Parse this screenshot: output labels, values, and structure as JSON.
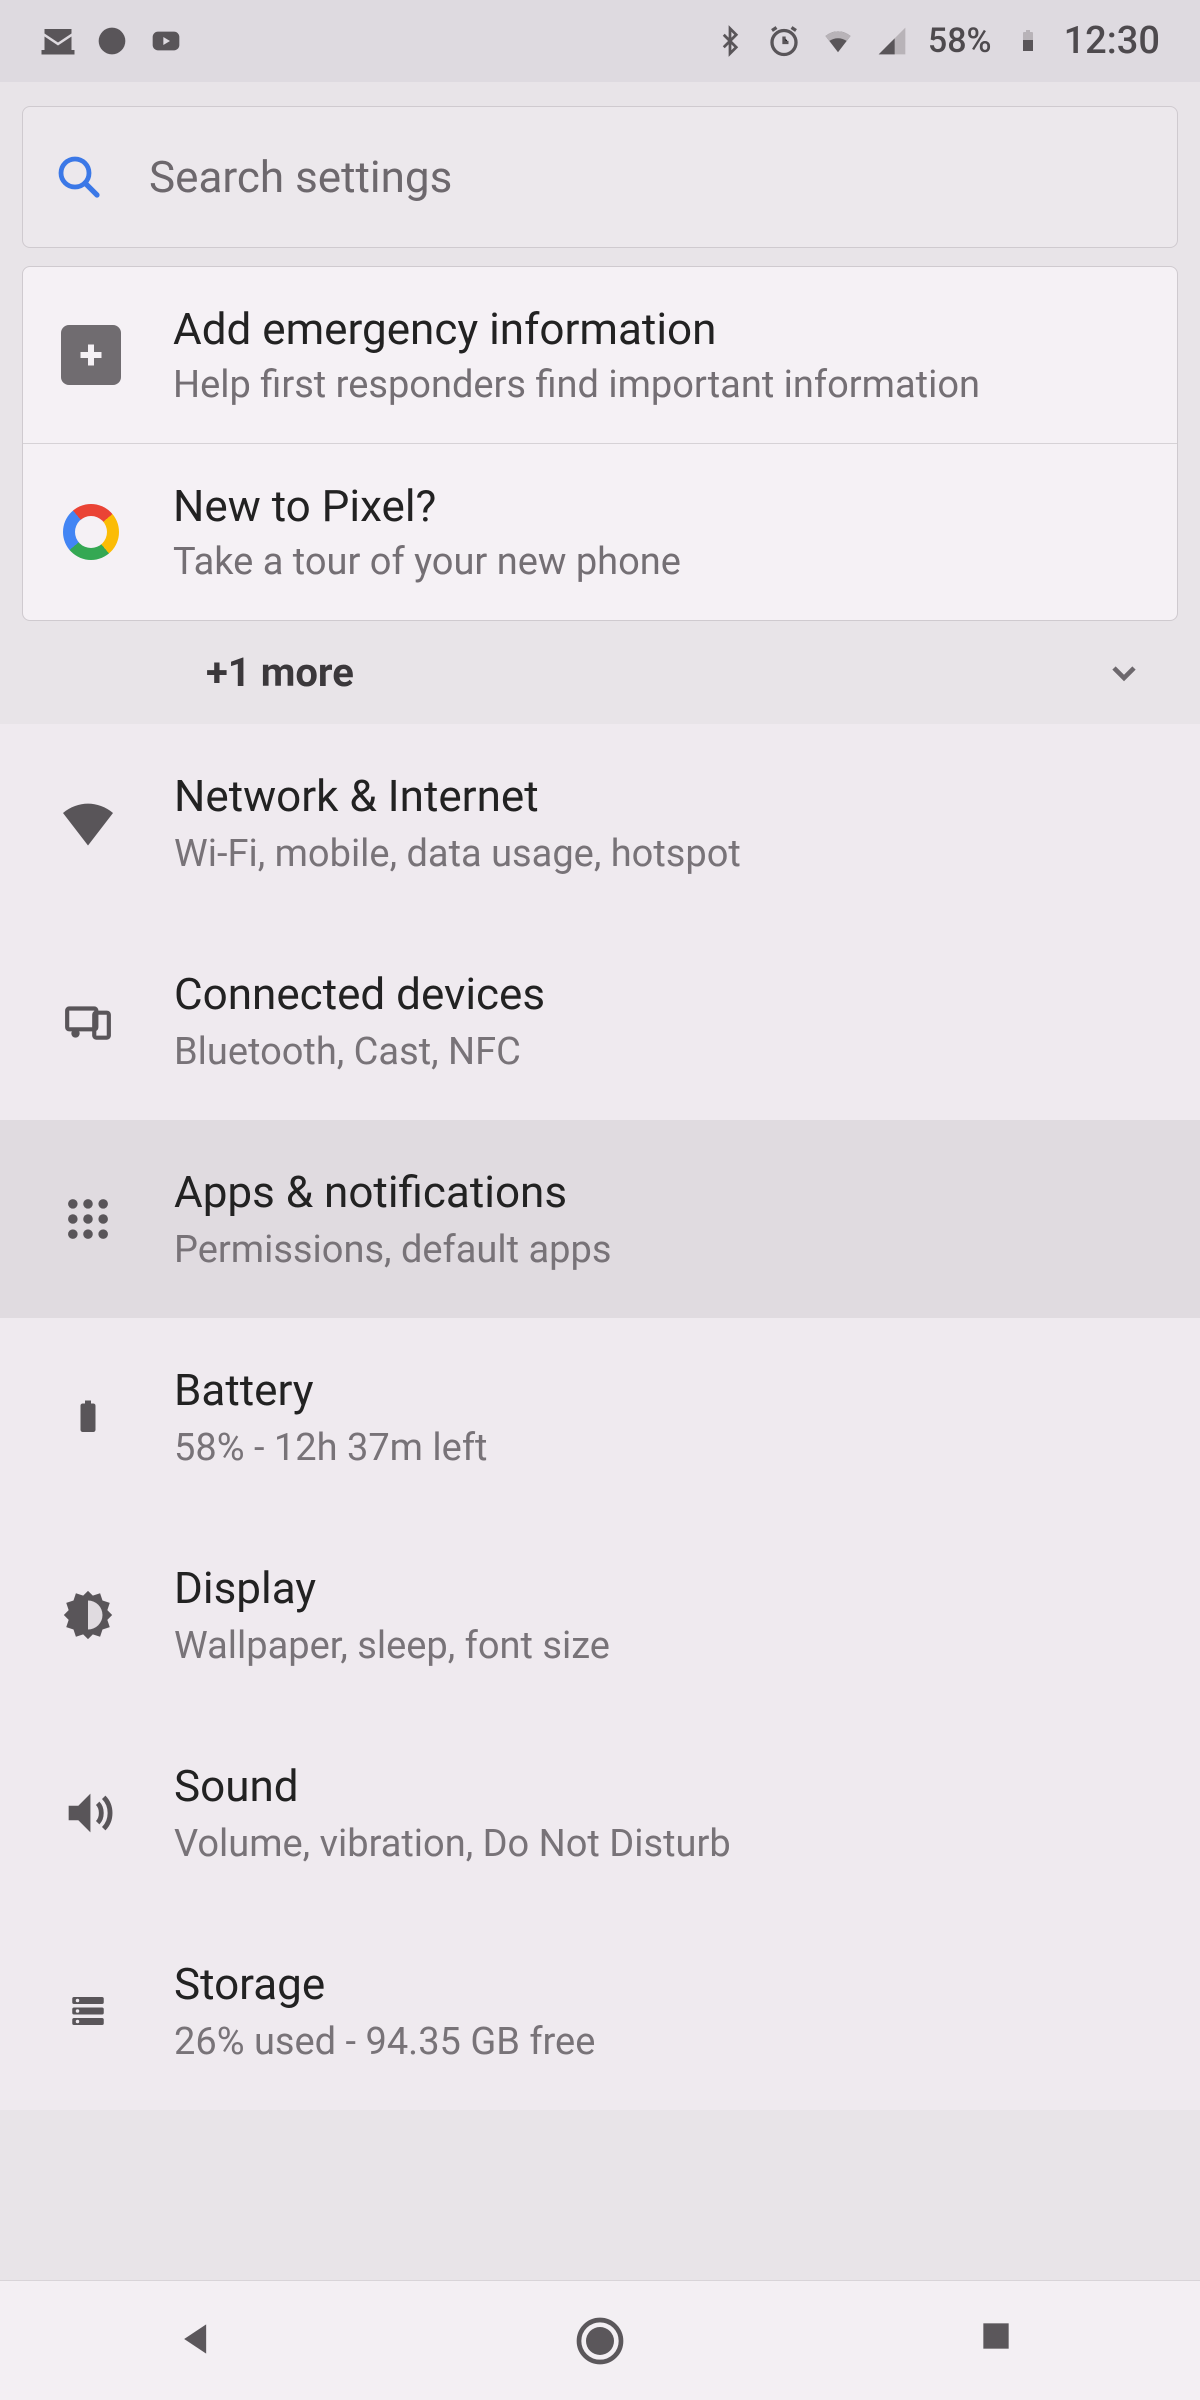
{
  "status": {
    "battery_pct": "58%",
    "time": "12:30"
  },
  "search": {
    "placeholder": "Search settings"
  },
  "suggestions": [
    {
      "title": "Add emergency information",
      "sub": "Help first responders find important information"
    },
    {
      "title": "New to Pixel?",
      "sub": "Take a tour of your new phone"
    }
  ],
  "more_label": "+1 more",
  "settings": [
    {
      "title": "Network & Internet",
      "sub": "Wi-Fi, mobile, data usage, hotspot",
      "icon": "wifi"
    },
    {
      "title": "Connected devices",
      "sub": "Bluetooth, Cast, NFC",
      "icon": "devices"
    },
    {
      "title": "Apps & notifications",
      "sub": "Permissions, default apps",
      "icon": "apps",
      "highlight": true
    },
    {
      "title": "Battery",
      "sub": "58% - 12h 37m left",
      "icon": "battery"
    },
    {
      "title": "Display",
      "sub": "Wallpaper, sleep, font size",
      "icon": "brightness"
    },
    {
      "title": "Sound",
      "sub": "Volume, vibration, Do Not Disturb",
      "icon": "sound"
    },
    {
      "title": "Storage",
      "sub": "26% used - 94.35 GB free",
      "icon": "storage"
    }
  ]
}
